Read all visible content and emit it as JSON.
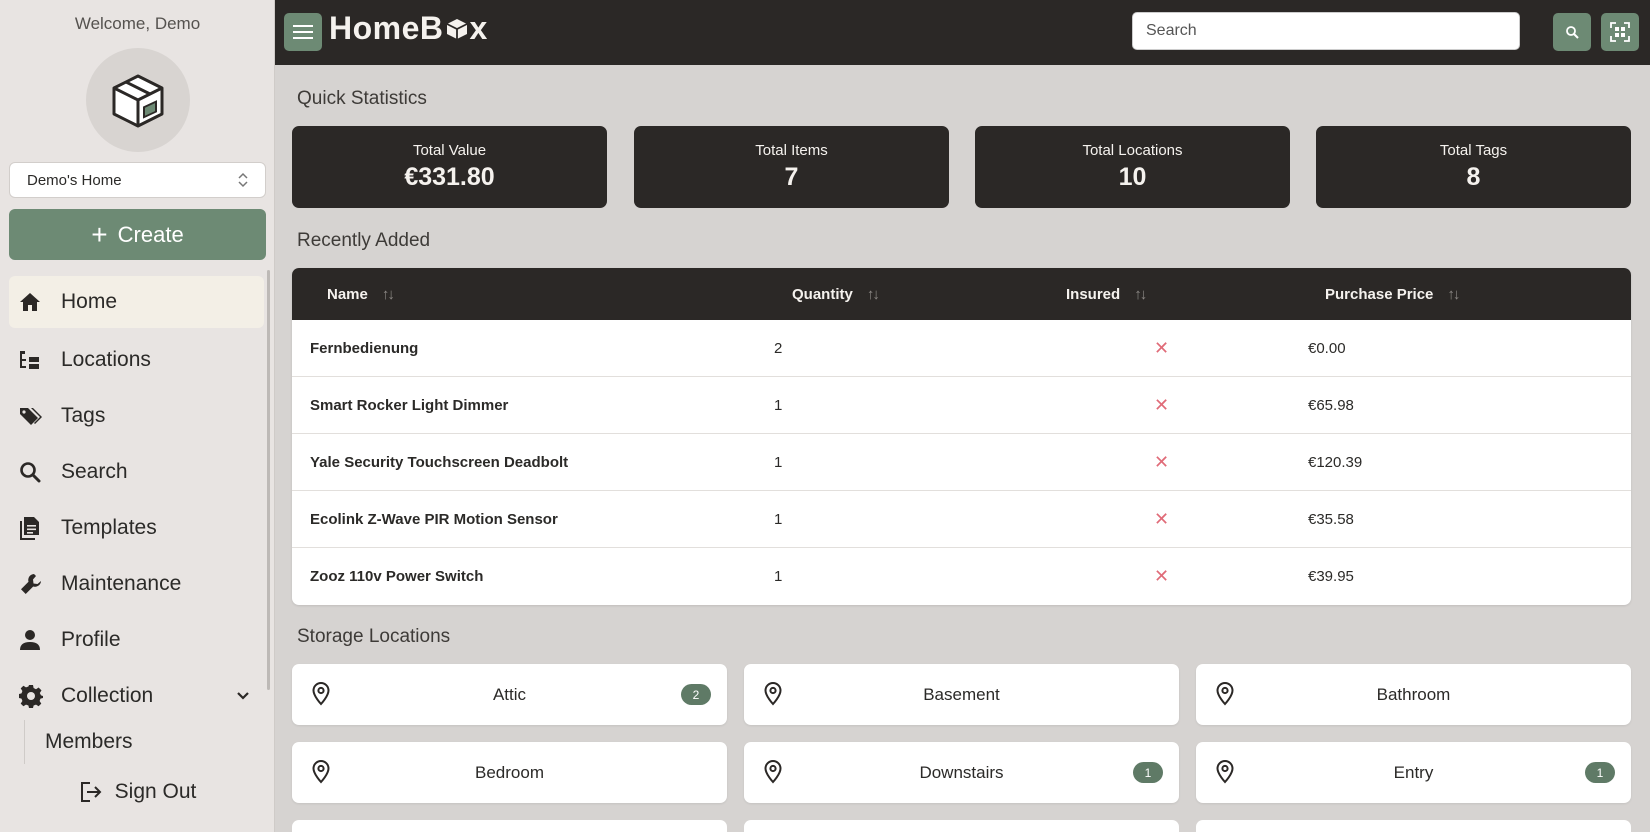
{
  "sidebar": {
    "welcome": "Welcome, Demo",
    "home_select": "Demo's Home",
    "create_label": "Create",
    "nav": [
      {
        "label": "Home",
        "icon": "home-icon"
      },
      {
        "label": "Locations",
        "icon": "tree-icon"
      },
      {
        "label": "Tags",
        "icon": "tags-icon"
      },
      {
        "label": "Search",
        "icon": "search-icon"
      },
      {
        "label": "Templates",
        "icon": "document-icon"
      },
      {
        "label": "Maintenance",
        "icon": "wrench-icon"
      },
      {
        "label": "Profile",
        "icon": "user-icon"
      },
      {
        "label": "Collection",
        "icon": "gear-icon"
      }
    ],
    "members": "Members",
    "sign_out": "Sign Out"
  },
  "topbar": {
    "logo": "HomeB",
    "logo_tail": "x",
    "search_placeholder": "Search"
  },
  "stats": {
    "title": "Quick Statistics",
    "items": [
      {
        "label": "Total Value",
        "value": "€331.80"
      },
      {
        "label": "Total Items",
        "value": "7"
      },
      {
        "label": "Total Locations",
        "value": "10"
      },
      {
        "label": "Total Tags",
        "value": "8"
      }
    ]
  },
  "recent": {
    "title": "Recently Added",
    "columns": [
      "Name",
      "Quantity",
      "Insured",
      "Purchase Price"
    ],
    "rows": [
      {
        "name": "Fernbedienung",
        "qty": "2",
        "insured": "✕",
        "price": "€0.00"
      },
      {
        "name": "Smart Rocker Light Dimmer",
        "qty": "1",
        "insured": "✕",
        "price": "€65.98"
      },
      {
        "name": "Yale Security Touchscreen Deadbolt",
        "qty": "1",
        "insured": "✕",
        "price": "€120.39"
      },
      {
        "name": "Ecolink Z-Wave PIR Motion Sensor",
        "qty": "1",
        "insured": "✕",
        "price": "€35.58"
      },
      {
        "name": "Zooz 110v Power Switch",
        "qty": "1",
        "insured": "✕",
        "price": "€39.95"
      }
    ]
  },
  "storage": {
    "title": "Storage Locations",
    "locations": [
      {
        "name": "Attic",
        "badge": "2"
      },
      {
        "name": "Basement",
        "badge": ""
      },
      {
        "name": "Bathroom",
        "badge": ""
      },
      {
        "name": "Bedroom",
        "badge": ""
      },
      {
        "name": "Downstairs",
        "badge": "1"
      },
      {
        "name": "Entry",
        "badge": "1"
      }
    ]
  },
  "colors": {
    "accent": "#6d8a74",
    "dark": "#2b2826",
    "badge": "#5f7a66",
    "insured_no": "#e06b78"
  }
}
